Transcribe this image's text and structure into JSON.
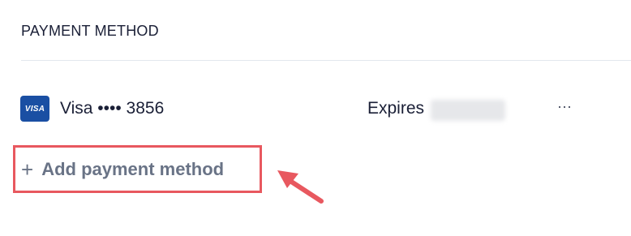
{
  "section": {
    "title": "PAYMENT METHOD"
  },
  "payment_methods": [
    {
      "brand": "VISA",
      "label": "Visa •••• 3856",
      "expires_label": "Expires",
      "expires_value_redacted": true,
      "menu": "···"
    }
  ],
  "actions": {
    "add_icon": "+",
    "add_label": "Add payment method"
  },
  "annotation": {
    "highlight_color": "#e8585f",
    "arrow_color": "#e8585f"
  }
}
